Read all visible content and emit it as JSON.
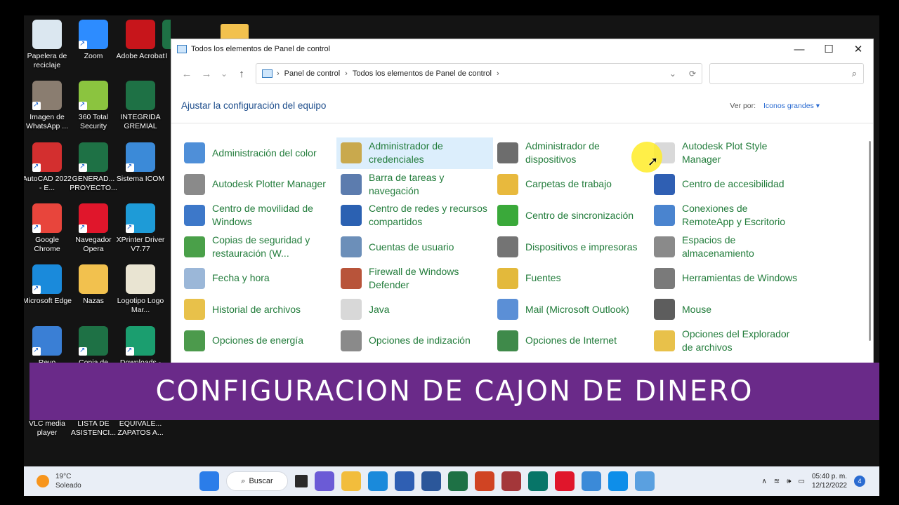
{
  "desktop": {
    "icons": [
      {
        "label": "Papelera de reciclaje",
        "color": "#dbe7f0"
      },
      {
        "label": "Zoom",
        "color": "#2d8cff"
      },
      {
        "label": "Adobe Acrobat",
        "color": "#c7151b"
      },
      {
        "label": "Imagen de WhatsApp ...",
        "color": "#8a7d70"
      },
      {
        "label": "360 Total Security",
        "color": "#8bc43f"
      },
      {
        "label": "INTEGRIDA GREMIAL",
        "color": "#1e7145"
      },
      {
        "label": "AutoCAD 2022 - E...",
        "color": "#d32f2f"
      },
      {
        "label": "GENERAD... PROYECTO...",
        "color": "#1e7145"
      },
      {
        "label": "Sistema ICOM",
        "color": "#3b8ad8"
      },
      {
        "label": "Google Chrome",
        "color": "#e8453c"
      },
      {
        "label": "Navegador Opera",
        "color": "#e0162b"
      },
      {
        "label": "XPrinter Driver V7.77",
        "color": "#1e9bd7"
      },
      {
        "label": "Microsoft Edge",
        "color": "#1a8adb"
      },
      {
        "label": "Nazas",
        "color": "#f2c14e"
      },
      {
        "label": "Logotipo Logo Mar...",
        "color": "#e9e4d2"
      },
      {
        "label": "Revo",
        "color": "#3a7fd5"
      },
      {
        "label": "Copia de",
        "color": "#1e7145"
      },
      {
        "label": "Downloads -",
        "color": "#1b9e6f"
      },
      {
        "label": "VLC media player",
        "color": "#141414"
      },
      {
        "label": "LISTA DE ASISTENCI...",
        "color": "#141414"
      },
      {
        "label": "EQUIVALE... ZAPATOS A...",
        "color": "#141414"
      }
    ],
    "partial_icons": [
      "I"
    ]
  },
  "window": {
    "title": "Todos los elementos de Panel de control",
    "buttons": {
      "minimize": "—",
      "maximize": "☐",
      "close": "✕"
    },
    "nav": {
      "back": "←",
      "forward": "→",
      "recent": "⌄",
      "up": "↑"
    },
    "address": {
      "crumb1": "Panel de control",
      "crumb2": "Todos los elementos de Panel de control",
      "sep": "›",
      "dropdown": "⌄",
      "refresh": "⟳"
    },
    "search": {
      "placeholder": "",
      "icon": "⌕"
    },
    "header": {
      "title": "Ajustar la configuración del equipo",
      "view_label": "Ver por:",
      "view_value": "Iconos grandes"
    },
    "items": [
      {
        "label": "Administración del color",
        "icon": "color-management-icon",
        "color": "#4f8fd8"
      },
      {
        "label": "Administrador de credenciales",
        "icon": "credential-manager-icon",
        "color": "#c9a94d"
      },
      {
        "label": "Administrador de dispositivos",
        "icon": "device-manager-icon",
        "color": "#6d6d6d"
      },
      {
        "label": "Autodesk Plot Style Manager",
        "icon": "plot-style-icon",
        "color": "#d9d9d9"
      },
      {
        "label": "Autodesk Plotter Manager",
        "icon": "plotter-icon",
        "color": "#8a8a8a"
      },
      {
        "label": "Barra de tareas y navegación",
        "icon": "taskbar-icon",
        "color": "#5c7cae"
      },
      {
        "label": "Carpetas de trabajo",
        "icon": "work-folders-icon",
        "color": "#e8b93d"
      },
      {
        "label": "Centro de accesibilidad",
        "icon": "accessibility-icon",
        "color": "#2f5fb3"
      },
      {
        "label": "Centro de movilidad de Windows",
        "icon": "mobility-icon",
        "color": "#3d78c9"
      },
      {
        "label": "Centro de redes y recursos compartidos",
        "icon": "network-icon",
        "color": "#2b61b2"
      },
      {
        "label": "Centro de sincronización",
        "icon": "sync-icon",
        "color": "#3aa93a"
      },
      {
        "label": "Conexiones de RemoteApp y Escritorio",
        "icon": "remoteapp-icon",
        "color": "#4a84cf"
      },
      {
        "label": "Copias de seguridad y restauración (W...",
        "icon": "backup-icon",
        "color": "#4aa049"
      },
      {
        "label": "Cuentas de usuario",
        "icon": "user-accounts-icon",
        "color": "#6c8fb9"
      },
      {
        "label": "Dispositivos e impresoras",
        "icon": "devices-printers-icon",
        "color": "#747474"
      },
      {
        "label": "Espacios de almacenamiento",
        "icon": "storage-spaces-icon",
        "color": "#8a8a8a"
      },
      {
        "label": "Fecha y hora",
        "icon": "date-time-icon",
        "color": "#9bb7d8"
      },
      {
        "label": "Firewall de Windows Defender",
        "icon": "firewall-icon",
        "color": "#b8543a"
      },
      {
        "label": "Fuentes",
        "icon": "fonts-icon",
        "color": "#e3b93b"
      },
      {
        "label": "Herramientas de Windows",
        "icon": "windows-tools-icon",
        "color": "#7a7a7a"
      },
      {
        "label": "Historial de archivos",
        "icon": "file-history-icon",
        "color": "#e8c14a"
      },
      {
        "label": "Java",
        "icon": "java-icon",
        "color": "#d8d8d8"
      },
      {
        "label": "Mail (Microsoft Outlook)",
        "icon": "mail-icon",
        "color": "#5b8fd6"
      },
      {
        "label": "Mouse",
        "icon": "mouse-icon",
        "color": "#5d5d5d"
      },
      {
        "label": "Opciones de energía",
        "icon": "power-options-icon",
        "color": "#4c9a4c"
      },
      {
        "label": "Opciones de indización",
        "icon": "indexing-icon",
        "color": "#8a8a8a"
      },
      {
        "label": "Opciones de Internet",
        "icon": "internet-options-icon",
        "color": "#3f8a4a"
      },
      {
        "label": "Opciones del Explorador de archivos",
        "icon": "explorer-options-icon",
        "color": "#e8c14a"
      }
    ]
  },
  "banner": {
    "text": "CONFIGURACION DE CAJON DE DINERO"
  },
  "taskbar": {
    "weather_temp": "19°C",
    "weather_desc": "Soleado",
    "search_label": "Buscar",
    "apps": [
      {
        "icon": "start-icon",
        "color": "#2b7de9"
      },
      {
        "icon": "task-view-icon",
        "color": "#2a2a2a"
      },
      {
        "icon": "teams-chat-icon",
        "color": "#6b5bd6"
      },
      {
        "icon": "file-explorer-icon",
        "color": "#f2bd3c"
      },
      {
        "icon": "edge-icon",
        "color": "#1a8adb"
      },
      {
        "icon": "store-icon",
        "color": "#2f5fb3"
      },
      {
        "icon": "word-icon",
        "color": "#2b579a"
      },
      {
        "icon": "excel-icon",
        "color": "#1e7145"
      },
      {
        "icon": "powerpoint-icon",
        "color": "#d04423"
      },
      {
        "icon": "access-icon",
        "color": "#a4373a"
      },
      {
        "icon": "publisher-icon",
        "color": "#077568"
      },
      {
        "icon": "opera-icon",
        "color": "#e0162b"
      },
      {
        "icon": "chart-app-icon",
        "color": "#3b8ad8"
      },
      {
        "icon": "teamviewer-icon",
        "color": "#0e8ee9"
      },
      {
        "icon": "control-panel-icon",
        "color": "#5aa0e0"
      }
    ],
    "tray_symbols": {
      "chevron": "∧",
      "wifi": "≋",
      "volume": "🕪",
      "battery": "▭"
    },
    "time": "05:40 p. m.",
    "date": "12/12/2022",
    "notifications": "4"
  }
}
